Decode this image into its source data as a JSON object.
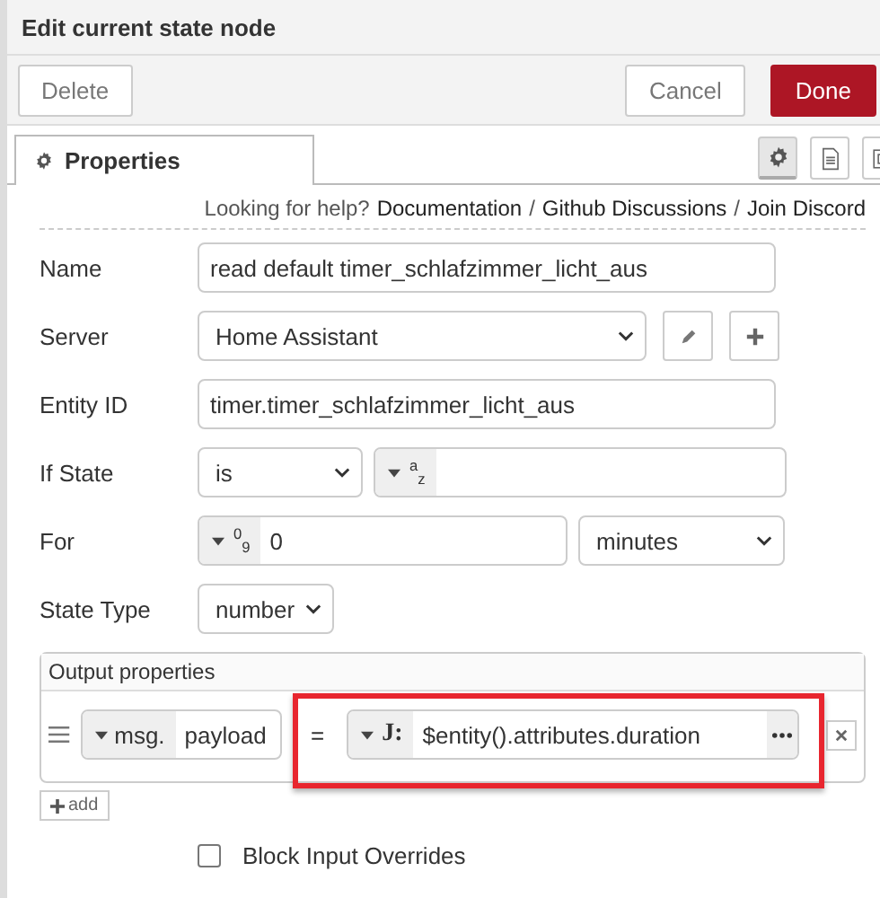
{
  "dialog": {
    "title": "Edit current state node"
  },
  "buttons": [
    {
      "label": "Delete",
      "kind": "secondary"
    },
    {
      "label": "Cancel",
      "kind": "secondary"
    },
    {
      "label": "Done",
      "kind": "primary"
    }
  ],
  "tabs": [
    {
      "label": "Properties",
      "selected": true
    }
  ],
  "side_tabs": [
    {
      "kind": "gear",
      "selected": true
    },
    {
      "kind": "document",
      "selected": false
    },
    {
      "kind": "frame",
      "selected": false
    }
  ],
  "help": [
    {
      "kind": "text",
      "text": "Looking for help?"
    },
    {
      "kind": "link",
      "text": "Documentation"
    },
    {
      "kind": "text",
      "text": "/"
    },
    {
      "kind": "link",
      "text": "Github Discussions"
    },
    {
      "kind": "text",
      "text": "/"
    },
    {
      "kind": "link",
      "text": "Join Discord"
    }
  ],
  "fields": [
    {
      "label": "Name",
      "kind": "text",
      "value": "read default timer_schlafzimmer_licht_aus"
    },
    {
      "label": "Server",
      "kind": "config_select",
      "value": "Home Assistant"
    },
    {
      "label": "Entity ID",
      "kind": "text",
      "value": "timer.timer_schlafzimmer_licht_aus"
    },
    {
      "label": "If State",
      "kind": "select_typed",
      "value": "is",
      "type_mark": "$^{a}$$_{z}$"
    },
    {
      "label": "For",
      "kind": "typed_select",
      "type_mark": "$^{0}$$_{9}$",
      "value": "0",
      "unit": "minutes"
    },
    {
      "label": "State Type",
      "kind": "select",
      "value": "number"
    }
  ],
  "output": {
    "title": "Output properties",
    "rows": [
      {
        "prefix": "msg.",
        "property": "payload",
        "operator": "=",
        "type_mark": "J:",
        "value": "$entity().attributes.duration",
        "highlighted": true
      }
    ],
    "add_label": "add"
  },
  "checkbox": {
    "label": "Block Input Overrides",
    "checked": false
  }
}
